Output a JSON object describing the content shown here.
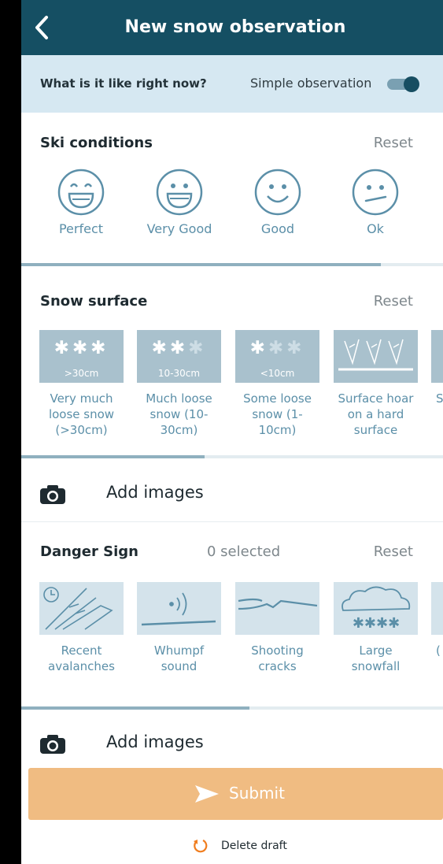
{
  "header": {
    "title": "New snow observation",
    "back_icon": "chevron-left-icon"
  },
  "simple": {
    "question": "What is it like right now?",
    "label": "Simple observation",
    "enabled": true
  },
  "ski": {
    "title": "Ski conditions",
    "reset": "Reset",
    "options": [
      {
        "label": "Perfect",
        "icon": "grin-face-icon"
      },
      {
        "label": "Very Good",
        "icon": "big-smile-face-icon"
      },
      {
        "label": "Good",
        "icon": "smile-face-icon"
      },
      {
        "label": "Ok",
        "icon": "meh-face-icon"
      }
    ]
  },
  "surface": {
    "title": "Snow surface",
    "reset": "Reset",
    "tiles": [
      {
        "depth": ">30cm",
        "label": "Very much loose snow (>30cm)"
      },
      {
        "depth": "10-30cm",
        "label": "Much loose snow (10-30cm)"
      },
      {
        "depth": "<10cm",
        "label": "Some loose snow (1-10cm)"
      },
      {
        "depth": "",
        "label": "Surface hoar on a hard surface"
      },
      {
        "depth": "",
        "label": "S"
      }
    ]
  },
  "add_images_1": {
    "label": "Add images"
  },
  "danger": {
    "title": "Danger Sign",
    "count": "0 selected",
    "reset": "Reset",
    "tiles": [
      {
        "label": "Recent avalanches",
        "icon": "avalanche-icon"
      },
      {
        "label": "Whumpf sound",
        "icon": "whumpf-icon"
      },
      {
        "label": "Shooting cracks",
        "icon": "cracks-icon"
      },
      {
        "label": "Large snowfall",
        "icon": "snowfall-cloud-icon"
      },
      {
        "label": "(",
        "icon": ""
      }
    ]
  },
  "add_images_2": {
    "label": "Add images"
  },
  "submit": {
    "label": "Submit"
  },
  "delete": {
    "label": "Delete draft"
  },
  "colors": {
    "header": "#154f63",
    "accent": "#5b8fa8",
    "submit": "#f0bc82",
    "delete_icon": "#f07d1e"
  }
}
